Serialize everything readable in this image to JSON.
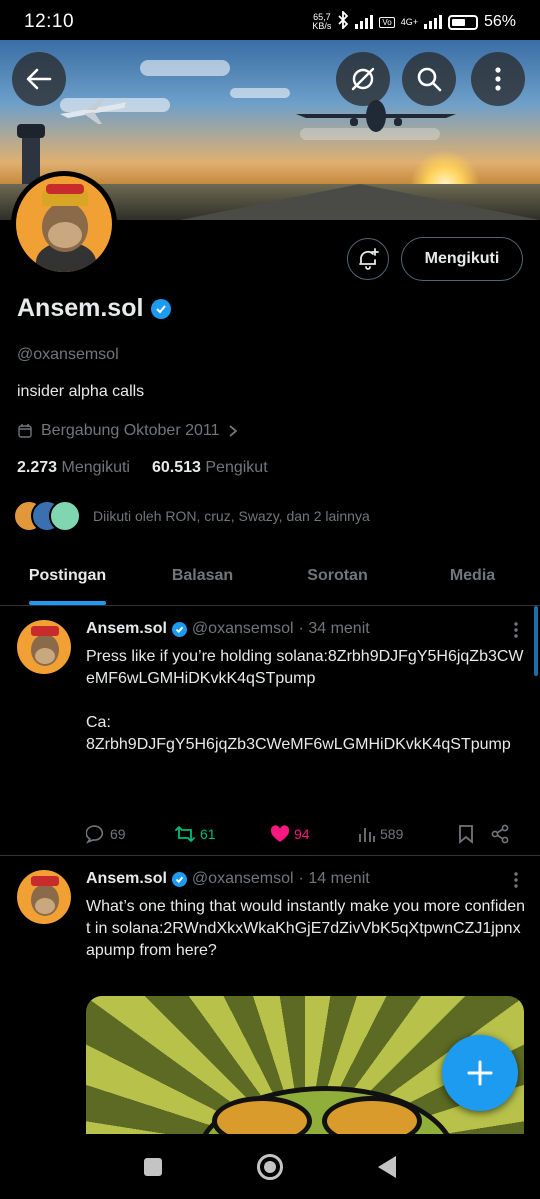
{
  "status_bar": {
    "time": "12:10",
    "net_speed_value": "65,7",
    "net_speed_unit": "KB/s",
    "network": "4G+",
    "battery": "56%"
  },
  "profile": {
    "follow_label": "Mengikuti",
    "display_name": "Ansem.sol",
    "handle": "@oxansemsol",
    "bio": "insider alpha calls",
    "joined": "Bergabung Oktober 2011",
    "following_count": "2.273",
    "following_label": "Mengikuti",
    "followers_count": "60.513",
    "followers_label": "Pengikut",
    "followed_by": "Diikuti oleh RON, cruz, Swazy, dan 2 lainnya"
  },
  "tabs": [
    {
      "label": "Postingan",
      "active": true
    },
    {
      "label": "Balasan",
      "active": false
    },
    {
      "label": "Sorotan",
      "active": false
    },
    {
      "label": "Media",
      "active": false
    }
  ],
  "posts": [
    {
      "name": "Ansem.sol",
      "handle": "@oxansemsol",
      "time": "· 34 menit",
      "text": "Press like if you’re holding solana:8Zrbh9DJFgY5H6jqZb3CWeMF6wLGMHiDKvkK4qSTpump\n\nCa:\n8Zrbh9DJFgY5H6jqZb3CWeMF6wLGMHiDKvkK4qSTpump",
      "replies": "69",
      "reposts": "61",
      "likes": "94",
      "views": "589"
    },
    {
      "name": "Ansem.sol",
      "handle": "@oxansemsol",
      "time": "· 14 menit",
      "text": "What’s one thing that would instantly make you more confident in solana:2RWndXkxWkaKhGjE7dZivVbK5qXtpwnCZJ1jpnxapump from here?"
    }
  ],
  "colors": {
    "accent": "#1d9bf0",
    "repost": "#00ba7c",
    "like": "#f91880",
    "muted": "#71767b"
  }
}
